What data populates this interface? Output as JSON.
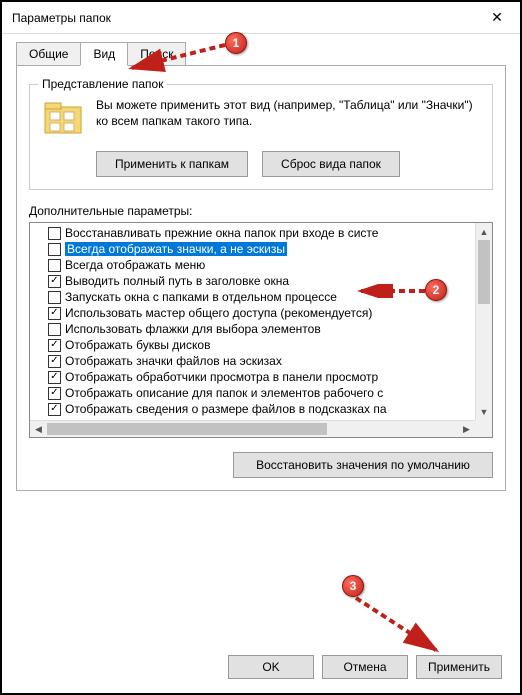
{
  "title": "Параметры папок",
  "tabs": {
    "general": "Общие",
    "view": "Вид",
    "search": "Поиск"
  },
  "groupbox": {
    "title": "Представление папок",
    "text": "Вы можете применить этот вид (например, \"Таблица\" или \"Значки\") ко всем папкам такого типа.",
    "apply_btn": "Применить к папкам",
    "reset_btn": "Сброс вида папок"
  },
  "advanced_label": "Дополнительные параметры:",
  "items": [
    {
      "checked": false,
      "text": "Восстанавливать прежние окна папок при входе в систе"
    },
    {
      "checked": false,
      "text": "Всегда отображать значки, а не эскизы",
      "selected": true
    },
    {
      "checked": false,
      "text": "Всегда отображать меню"
    },
    {
      "checked": true,
      "text": "Выводить полный путь в заголовке окна"
    },
    {
      "checked": false,
      "text": "Запускать окна с папками в отдельном процессе"
    },
    {
      "checked": true,
      "text": "Использовать мастер общего доступа (рекомендуется)"
    },
    {
      "checked": false,
      "text": "Использовать флажки для выбора элементов"
    },
    {
      "checked": true,
      "text": "Отображать буквы дисков"
    },
    {
      "checked": true,
      "text": "Отображать значки файлов на эскизах"
    },
    {
      "checked": true,
      "text": "Отображать обработчики просмотра в панели просмотр"
    },
    {
      "checked": true,
      "text": "Отображать описание для папок и элементов рабочего с"
    },
    {
      "checked": true,
      "text": "Отображать сведения о размере файлов в подсказках па"
    }
  ],
  "restore_defaults": "Восстановить значения по умолчанию",
  "dialog": {
    "ok": "OK",
    "cancel": "Отмена",
    "apply": "Применить"
  },
  "callouts": {
    "c1": "1",
    "c2": "2",
    "c3": "3"
  }
}
